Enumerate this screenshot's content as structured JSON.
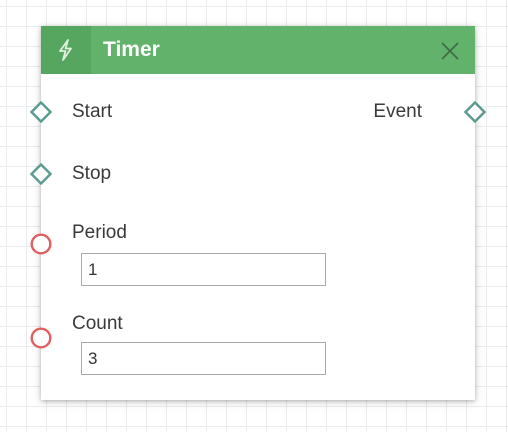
{
  "node": {
    "title": "Timer",
    "header_icon": "lightning-bolt-icon",
    "close_icon": "close-icon",
    "colors": {
      "header": "#62b26b",
      "header_icon_bg": "#57a660",
      "event_port": "#5a9a8f",
      "data_port": "#e06060"
    },
    "inputs": [
      {
        "label": "Start",
        "port_type": "event"
      },
      {
        "label": "Stop",
        "port_type": "event"
      },
      {
        "label": "Period",
        "port_type": "data",
        "value": "1"
      },
      {
        "label": "Count",
        "port_type": "data",
        "value": "3"
      }
    ],
    "outputs": [
      {
        "label": "Event",
        "port_type": "event"
      }
    ]
  }
}
